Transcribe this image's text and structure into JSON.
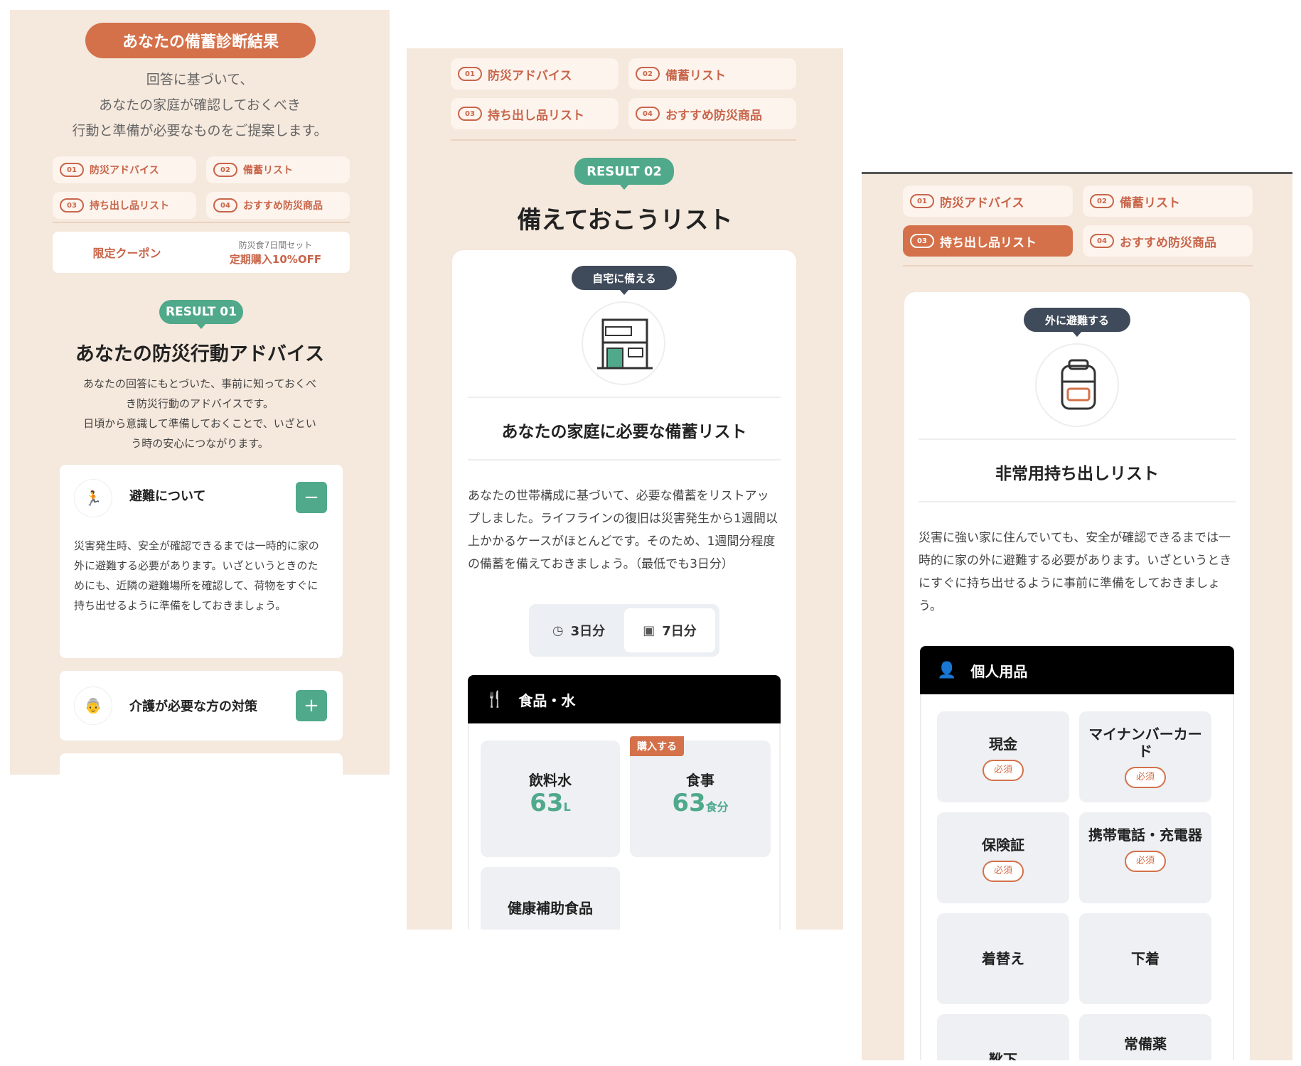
{
  "panel1": {
    "header_title": "あなたの備蓄診断結果",
    "intro_lines": [
      "回答に基づいて、",
      "あなたの家庭が確認しておくべき",
      "行動と準備が必要なものをご提案します。"
    ],
    "tabs": [
      {
        "num": "01",
        "label": "防災アドバイス"
      },
      {
        "num": "02",
        "label": "備蓄リスト"
      },
      {
        "num": "03",
        "label": "持ち出し品リスト"
      },
      {
        "num": "04",
        "label": "おすすめ防災商品"
      }
    ],
    "coupon": {
      "label": "限定クーポン",
      "sub": "防災食7日間セット",
      "offer": "定期購入10%OFF"
    },
    "result_badge": "RESULT 01",
    "title": "あなたの防災行動アドバイス",
    "desc_lines": [
      "あなたの回答にもとづいた、事前に知っておくべ",
      "き防災行動のアドバイスです。",
      "日頃から意識して準備しておくことで、いざとい",
      "う時の安心につながります。"
    ],
    "accordions": [
      {
        "label": "避難について",
        "toggle": "−",
        "body": "災害発生時、安全が確認できるまでは一時的に家の外に避難する必要があります。いざというときのためにも、近隣の避難場所を確認して、荷物をすぐに持ち出せるように準備をしておきましょう。"
      },
      {
        "label": "介護が必要な方の対策",
        "toggle": "+"
      }
    ]
  },
  "panel2": {
    "tabs": [
      {
        "num": "01",
        "label": "防災アドバイス"
      },
      {
        "num": "02",
        "label": "備蓄リスト"
      },
      {
        "num": "03",
        "label": "持ち出し品リスト"
      },
      {
        "num": "04",
        "label": "おすすめ防災商品"
      }
    ],
    "result_badge": "RESULT 02",
    "title": "備えておこうリスト",
    "card_badge": "自宅に備える",
    "card_title": "あなたの家庭に必要な備蓄リスト",
    "card_body": "あなたの世帯構成に基づいて、必要な備蓄をリストアップしました。ライフラインの復旧は災害発生から1週間以上かかるケースがほとんどです。そのため、1週間分程度の備蓄を備えておきましょう。（最低でも3日分）",
    "segments": [
      {
        "icon": "clock-icon",
        "label": "3日分"
      },
      {
        "icon": "calendar-icon",
        "label": "7日分"
      }
    ],
    "category": {
      "icon": "utensils-icon",
      "label": "食品・水"
    },
    "items": [
      {
        "name": "飲料水",
        "value": "63",
        "unit": "L"
      },
      {
        "name": "食事",
        "value": "63",
        "unit": "食分",
        "buy": "購入する"
      },
      {
        "name": "健康補助食品"
      }
    ]
  },
  "panel3": {
    "tabs": [
      {
        "num": "01",
        "label": "防災アドバイス"
      },
      {
        "num": "02",
        "label": "備蓄リスト"
      },
      {
        "num": "03",
        "label": "持ち出し品リスト"
      },
      {
        "num": "04",
        "label": "おすすめ防災商品"
      }
    ],
    "card_badge": "外に避難する",
    "card_title": "非常用持ち出しリスト",
    "card_body": "災害に強い家に住んでいても、安全が確認できるまでは一時的に家の外に避難する必要があります。いざというときにすぐに持ち出せるように事前に準備をしておきましょう。",
    "category": {
      "icon": "person-icon",
      "label": "個人用品"
    },
    "items": [
      {
        "name": "現金",
        "badge": "必須"
      },
      {
        "name": "マイナンバーカード",
        "badge": "必須"
      },
      {
        "name": "保険証",
        "badge": "必須"
      },
      {
        "name": "携帯電話・充電器",
        "badge": "必須"
      },
      {
        "name": "着替え"
      },
      {
        "name": "下着"
      },
      {
        "name": "靴下"
      },
      {
        "name": "常備薬"
      }
    ]
  },
  "colors": {
    "accent": "#d4714a",
    "green": "#4fa98a",
    "panel_bg": "#f5e8dc",
    "dark_badge": "#3f4a5a"
  }
}
